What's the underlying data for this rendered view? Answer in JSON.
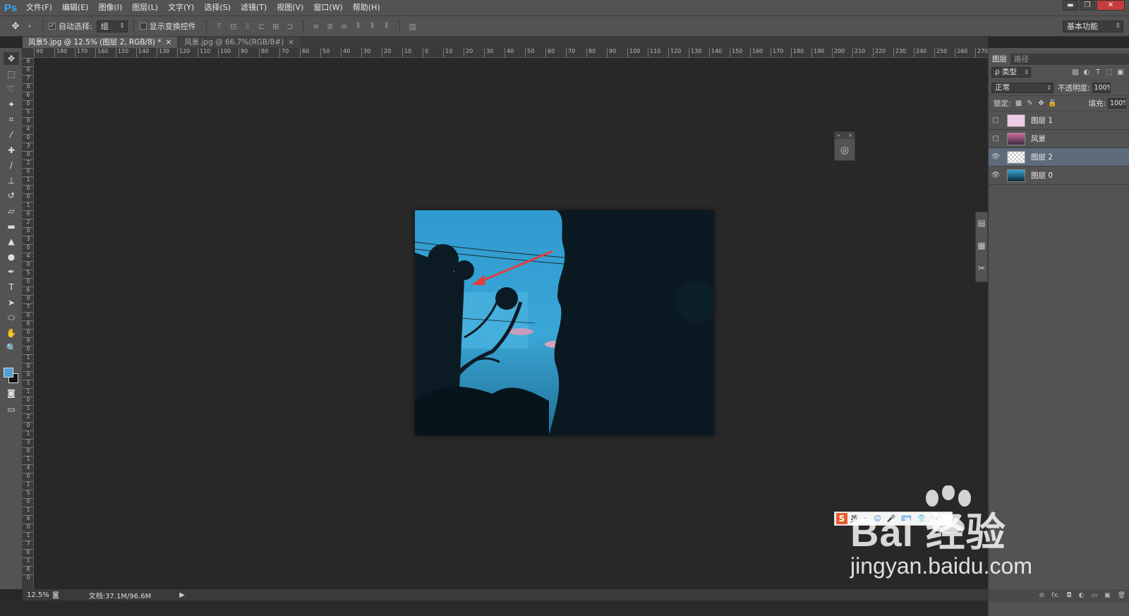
{
  "app": {
    "logo": "Ps",
    "menu": [
      "文件(F)",
      "编辑(E)",
      "图像(I)",
      "图层(L)",
      "文字(Y)",
      "选择(S)",
      "滤镜(T)",
      "视图(V)",
      "窗口(W)",
      "帮助(H)"
    ],
    "window_controls": {
      "minimize": "▬",
      "restore": "❐",
      "close": "✕"
    }
  },
  "options": {
    "move_icon": "move-tool-icon",
    "auto_select_label": "自动选择:",
    "auto_select_checked": true,
    "auto_select_value": "组",
    "show_transform_label": "显示变换控件",
    "show_transform_checked": false,
    "workspace": "基本功能"
  },
  "tabs": [
    {
      "label": "风景5.jpg @ 12.5% (图层 2, RGB/8) *",
      "close": "×",
      "active": true
    },
    {
      "label": "风景.jpg @ 66.7%(RGB/8#)",
      "close": "×",
      "active": false
    }
  ],
  "ruler_h": [
    "90",
    "180",
    "170",
    "160",
    "150",
    "140",
    "130",
    "120",
    "110",
    "100",
    "90",
    "80",
    "70",
    "60",
    "50",
    "40",
    "30",
    "20",
    "10",
    "0",
    "10",
    "20",
    "30",
    "40",
    "50",
    "60",
    "70",
    "80",
    "90",
    "100",
    "110",
    "120",
    "130",
    "140",
    "150",
    "160",
    "170",
    "180",
    "190",
    "200",
    "210",
    "220",
    "230",
    "240",
    "250",
    "260",
    "270"
  ],
  "ruler_v": [
    "8",
    "0",
    "7",
    "0",
    "6",
    "0",
    "5",
    "0",
    "4",
    "0",
    "3",
    "0",
    "2",
    "0",
    "1",
    "0",
    "0",
    "1",
    "0",
    "2",
    "0",
    "3",
    "0",
    "4",
    "0",
    "5",
    "0",
    "6",
    "0",
    "7",
    "0",
    "8",
    "0",
    "9",
    "0",
    "1",
    "0",
    "0",
    "1",
    "1",
    "0",
    "1",
    "2",
    "0",
    "1",
    "3",
    "0",
    "1",
    "4",
    "0",
    "1",
    "5",
    "0",
    "1",
    "6",
    "0",
    "1",
    "7",
    "0",
    "1",
    "8",
    "0"
  ],
  "tools": [
    {
      "name": "move-tool-icon",
      "glyph": "✥"
    },
    {
      "name": "marquee-tool-icon",
      "glyph": "⬚"
    },
    {
      "name": "lasso-tool-icon",
      "glyph": "➰"
    },
    {
      "name": "magic-wand-tool-icon",
      "glyph": "✦"
    },
    {
      "name": "crop-tool-icon",
      "glyph": "⌗"
    },
    {
      "name": "eyedropper-tool-icon",
      "glyph": "⁄"
    },
    {
      "name": "healing-brush-tool-icon",
      "glyph": "✚"
    },
    {
      "name": "brush-tool-icon",
      "glyph": "∕"
    },
    {
      "name": "clone-stamp-tool-icon",
      "glyph": "⊥"
    },
    {
      "name": "history-brush-tool-icon",
      "glyph": "↺"
    },
    {
      "name": "eraser-tool-icon",
      "glyph": "▱"
    },
    {
      "name": "gradient-tool-icon",
      "glyph": "▬"
    },
    {
      "name": "blur-tool-icon",
      "glyph": "▲"
    },
    {
      "name": "dodge-tool-icon",
      "glyph": "●"
    },
    {
      "name": "pen-tool-icon",
      "glyph": "✒"
    },
    {
      "name": "type-tool-icon",
      "glyph": "T"
    },
    {
      "name": "path-selection-tool-icon",
      "glyph": "➤"
    },
    {
      "name": "shape-tool-icon",
      "glyph": "⬭"
    },
    {
      "name": "hand-tool-icon",
      "glyph": "✋"
    },
    {
      "name": "zoom-tool-icon",
      "glyph": "🔍"
    }
  ],
  "panels": {
    "tabs": [
      "图层",
      "路径"
    ],
    "filter_type": "ρ 类型",
    "blend_mode": "正常",
    "opacity_label": "不透明度:",
    "opacity_value": "100%",
    "lock_label": "锁定:",
    "fill_label": "填充:",
    "fill_value": "100%",
    "layers": [
      {
        "name": "图层 1",
        "visible": false,
        "selected": false,
        "thumb": "checker-pink"
      },
      {
        "name": "风景",
        "visible": false,
        "selected": false,
        "thumb": "pink"
      },
      {
        "name": "图层 2",
        "visible": true,
        "selected": true,
        "thumb": "checker"
      },
      {
        "name": "图层 0",
        "visible": true,
        "selected": false,
        "thumb": "sky"
      }
    ],
    "footer_icons": [
      "link-icon",
      "fx-icon",
      "mask-icon",
      "adjustment-icon",
      "folder-icon",
      "new-layer-icon",
      "trash-icon"
    ],
    "footer_glyphs": [
      "⊖",
      "fx.",
      "◘",
      "◐",
      "▭",
      "▣",
      "🗑"
    ]
  },
  "status": {
    "zoom": "12.5%",
    "doc_info": "文档:37.1M/96.6M",
    "arrow": "▶"
  },
  "ime": {
    "logo": "S",
    "label": "英",
    "icons": [
      "·,",
      "☺",
      "🎤",
      "⌨",
      "👕",
      "✂"
    ]
  },
  "watermark": {
    "brand": "Bai  经验",
    "domain": "jingyan.baidu.com"
  },
  "colors": {
    "foreground": "#4ea1d3",
    "background": "#111111",
    "accent": "#31a8ff"
  }
}
